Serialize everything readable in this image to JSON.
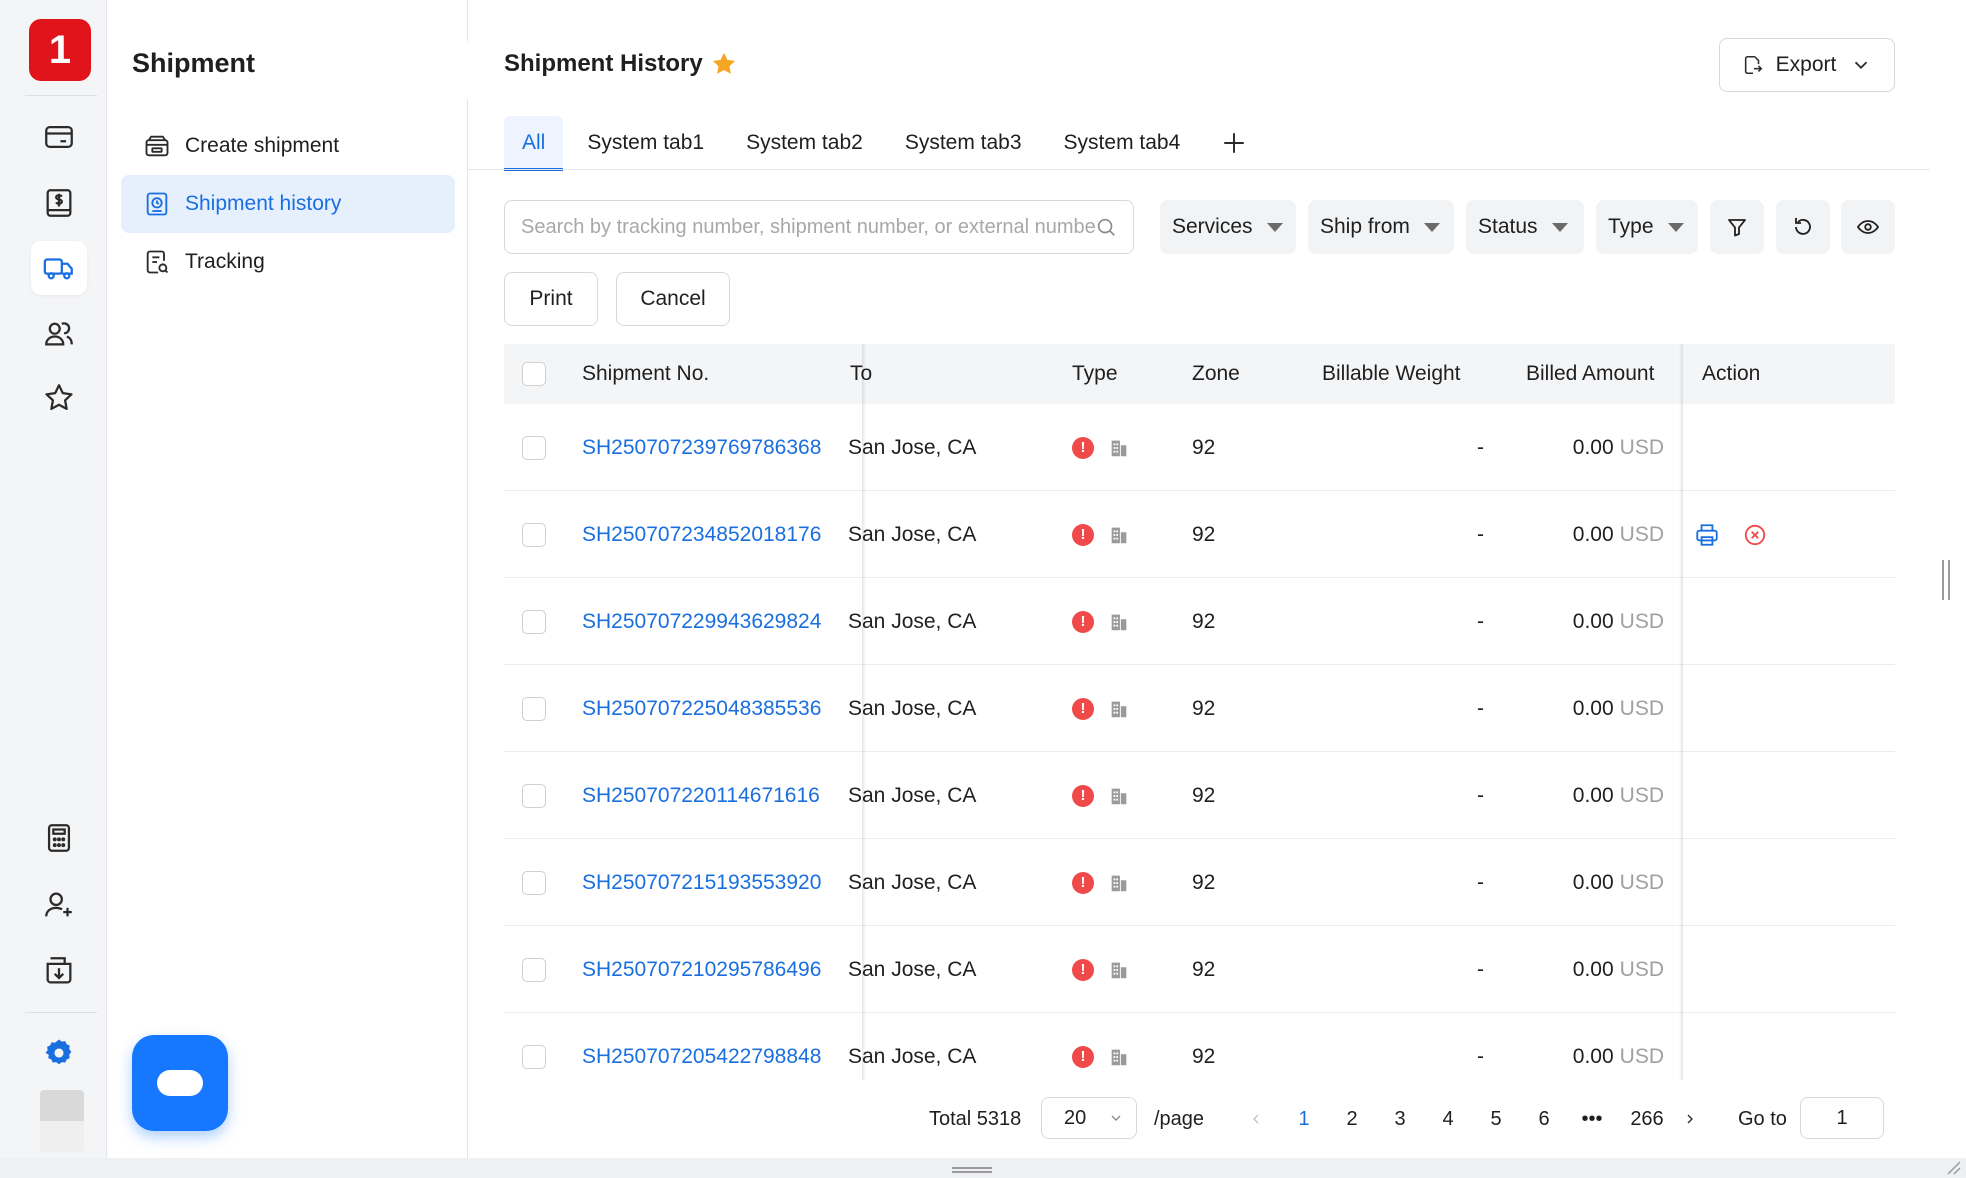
{
  "rail": {
    "logo_text": "1",
    "brand_color": "#e1141c",
    "items": [
      {
        "icon": "wallet-icon"
      },
      {
        "icon": "billing-icon"
      },
      {
        "icon": "truck-icon"
      },
      {
        "icon": "users-icon"
      },
      {
        "icon": "star-icon"
      },
      {
        "icon": "calculator-icon"
      },
      {
        "icon": "add-user-icon"
      },
      {
        "icon": "import-icon"
      },
      {
        "icon": "gear-icon"
      }
    ]
  },
  "subnav": {
    "title": "Shipment",
    "items": [
      {
        "label": "Create shipment",
        "icon": "create-shipment-icon"
      },
      {
        "label": "Shipment history",
        "icon": "history-icon"
      },
      {
        "label": "Tracking",
        "icon": "tracking-icon"
      }
    ]
  },
  "header": {
    "title": "Shipment History",
    "export_label": "Export"
  },
  "tabs": [
    "All",
    "System tab1",
    "System tab2",
    "System tab3",
    "System tab4"
  ],
  "search": {
    "placeholder": "Search by tracking number, shipment number, or external number"
  },
  "filters": [
    "Services",
    "Ship from",
    "Status",
    "Type"
  ],
  "actions": {
    "print": "Print",
    "cancel": "Cancel"
  },
  "table": {
    "columns": {
      "shipment_no": "Shipment No.",
      "to": "To",
      "type": "Type",
      "zone": "Zone",
      "billable_weight": "Billable Weight",
      "billed_amount": "Billed Amount",
      "action": "Action"
    },
    "rows": [
      {
        "shipment_no": "SH250707239769786368",
        "to": "San Jose, CA",
        "zone": "92",
        "weight": "-",
        "amount": "0.00",
        "currency": "USD"
      },
      {
        "shipment_no": "SH250707234852018176",
        "to": "San Jose, CA",
        "zone": "92",
        "weight": "-",
        "amount": "0.00",
        "currency": "USD"
      },
      {
        "shipment_no": "SH250707229943629824",
        "to": "San Jose, CA",
        "zone": "92",
        "weight": "-",
        "amount": "0.00",
        "currency": "USD"
      },
      {
        "shipment_no": "SH250707225048385536",
        "to": "San Jose, CA",
        "zone": "92",
        "weight": "-",
        "amount": "0.00",
        "currency": "USD"
      },
      {
        "shipment_no": "SH250707220114671616",
        "to": "San Jose, CA",
        "zone": "92",
        "weight": "-",
        "amount": "0.00",
        "currency": "USD"
      },
      {
        "shipment_no": "SH250707215193553920",
        "to": "San Jose, CA",
        "zone": "92",
        "weight": "-",
        "amount": "0.00",
        "currency": "USD"
      },
      {
        "shipment_no": "SH250707210295786496",
        "to": "San Jose, CA",
        "zone": "92",
        "weight": "-",
        "amount": "0.00",
        "currency": "USD"
      },
      {
        "shipment_no": "SH250707205422798848",
        "to": "San Jose, CA",
        "zone": "92",
        "weight": "-",
        "amount": "0.00",
        "currency": "USD"
      }
    ]
  },
  "pagination": {
    "total_label": "Total 5318",
    "page_size": "20",
    "per_page_label": "/page",
    "pages": [
      "1",
      "2",
      "3",
      "4",
      "5",
      "6"
    ],
    "ellipsis": "•••",
    "last_page": "266",
    "current": "1",
    "goto_label": "Go to",
    "goto_value": "1"
  },
  "colors": {
    "accent": "#1a6fe0",
    "danger": "#f0494a",
    "star": "#f5a623"
  }
}
